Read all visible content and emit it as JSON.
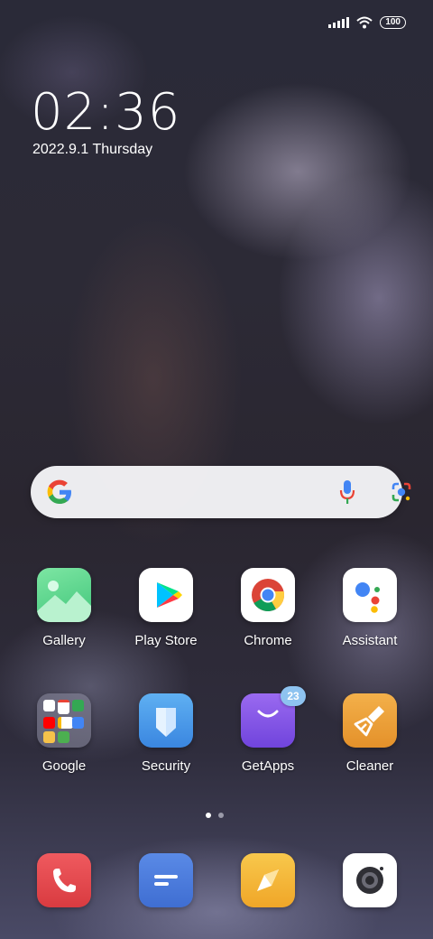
{
  "status": {
    "battery": "100"
  },
  "clock": {
    "time": "02:36",
    "date": "2022.9.1 Thursday"
  },
  "search": {
    "google_letter": "G"
  },
  "apps_row1": [
    {
      "label": "Gallery"
    },
    {
      "label": "Play Store"
    },
    {
      "label": "Chrome"
    },
    {
      "label": "Assistant"
    }
  ],
  "apps_row2": [
    {
      "label": "Google"
    },
    {
      "label": "Security"
    },
    {
      "label": "GetApps",
      "badge": "23"
    },
    {
      "label": "Cleaner"
    }
  ],
  "dock": [
    {
      "icon": "phone-icon"
    },
    {
      "icon": "messages-icon"
    },
    {
      "icon": "browser-compass-icon"
    },
    {
      "icon": "camera-icon"
    }
  ],
  "colors": {
    "gallery": "#5fd38a",
    "security": "#4a9be8",
    "getapps": "#8a5ce6",
    "cleaner": "#eda33b",
    "phone": "#e5484d",
    "messages": "#4a78d8",
    "browser": "#f5b93a",
    "camera": "#ffffff",
    "badge": "#8ec3f0",
    "page_dot_active": "#ffffff",
    "page_dot_inactive": "#9a9aa8"
  },
  "pager": {
    "pages": 2,
    "active": 1
  }
}
